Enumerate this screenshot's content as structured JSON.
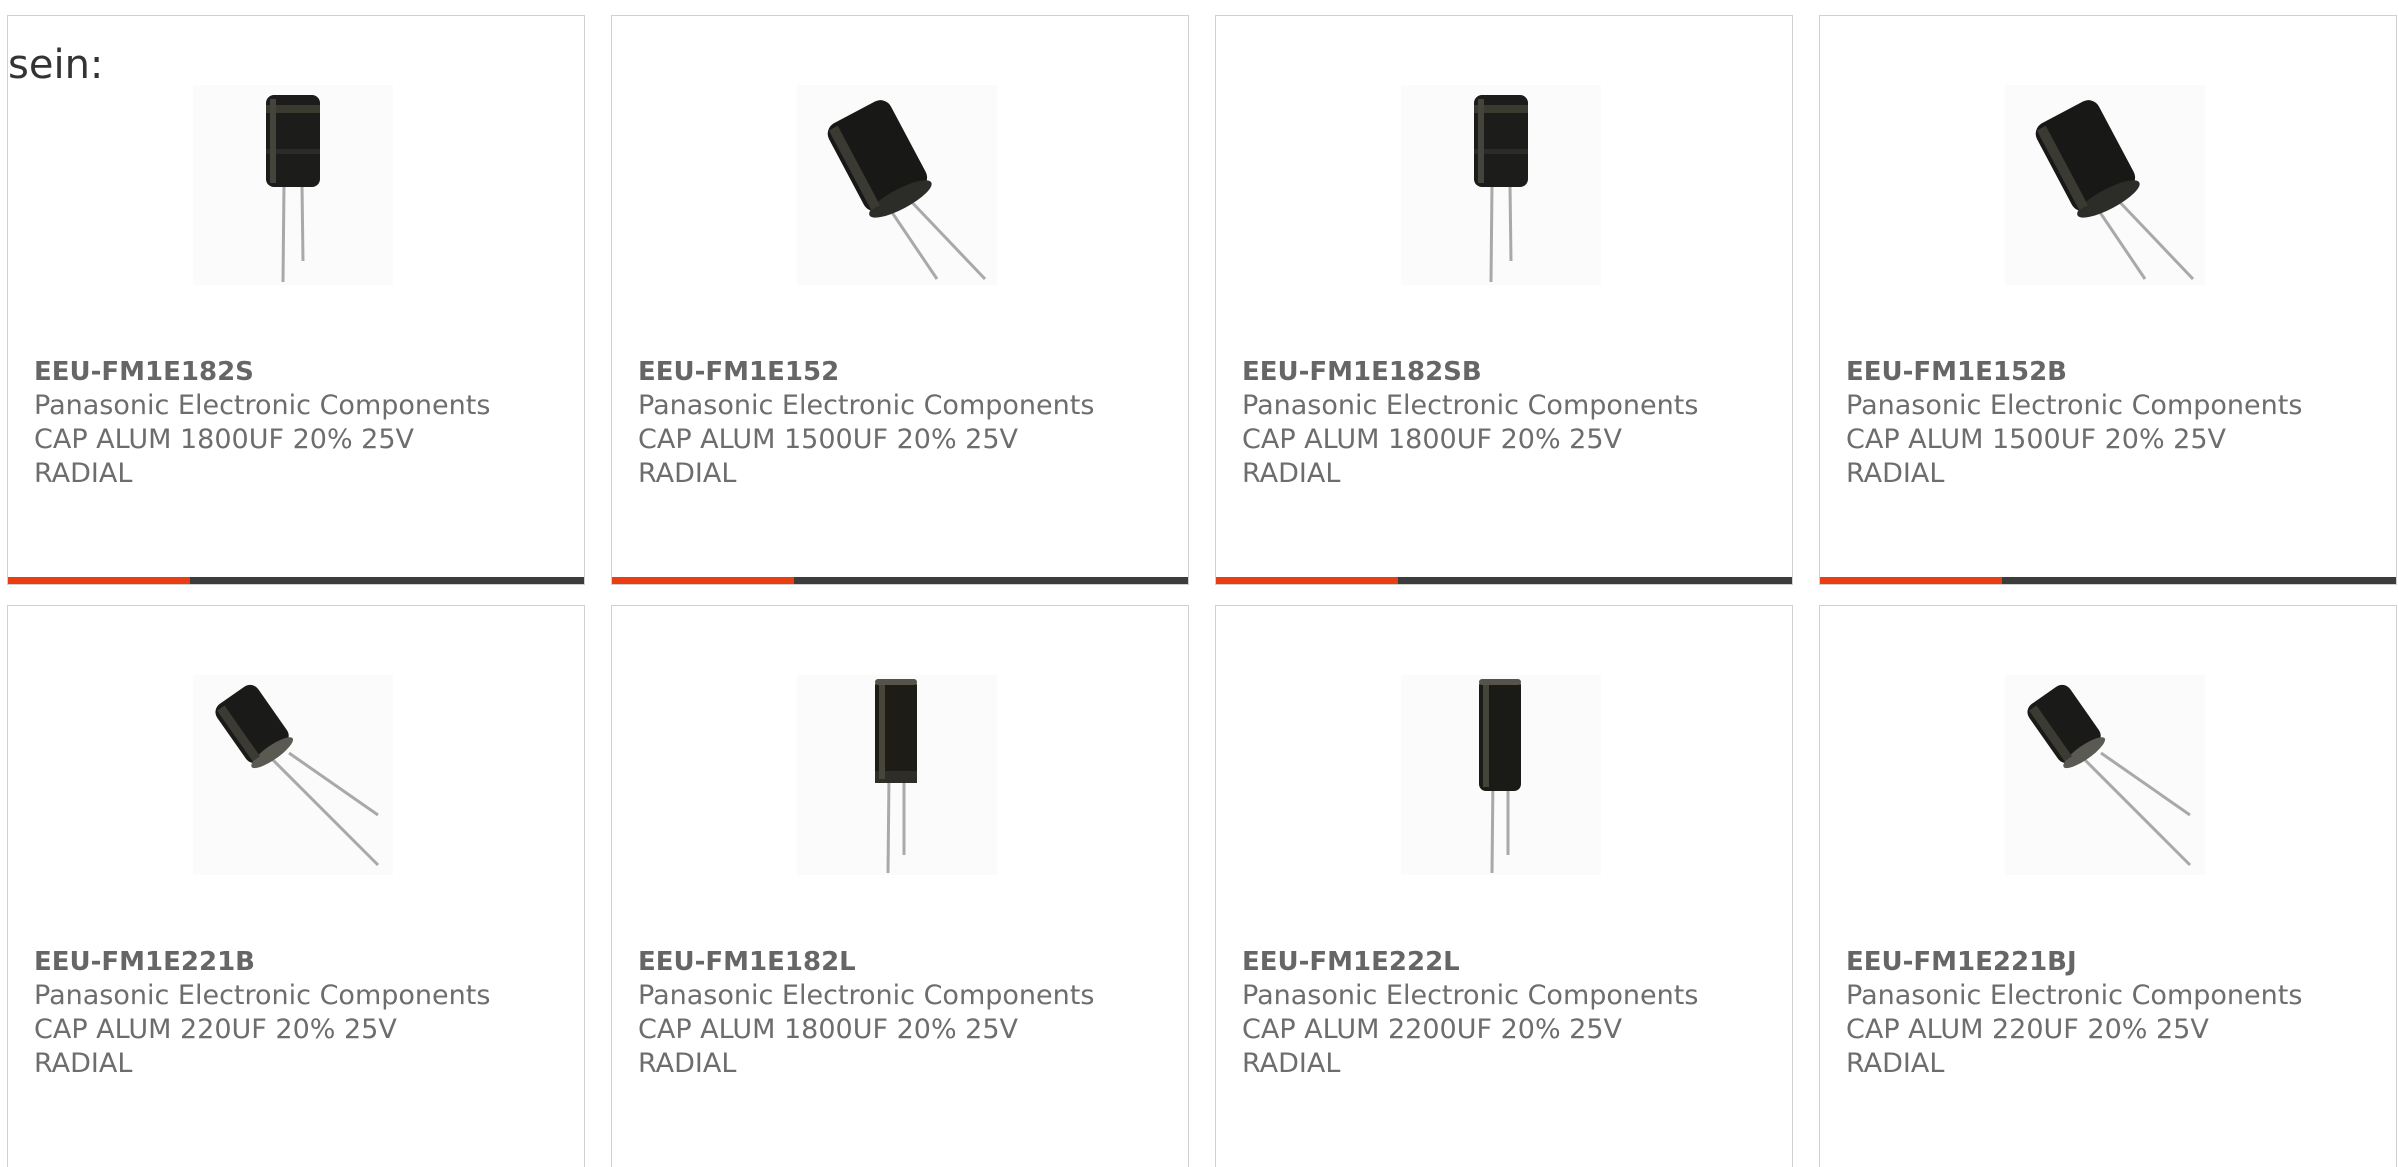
{
  "intro_text": "sein:",
  "colors": {
    "accent": "#ea3d12",
    "bar": "#3c3c3c"
  },
  "products": [
    {
      "part_number": "EEU-FM1E182S",
      "manufacturer": "Panasonic Electronic Components",
      "desc_line1": "CAP ALUM 1800UF 20% 25V",
      "desc_line2": "RADIAL",
      "image": "capacitor-upright-icon"
    },
    {
      "part_number": "EEU-FM1E152",
      "manufacturer": "Panasonic Electronic Components",
      "desc_line1": "CAP ALUM 1500UF 20% 25V",
      "desc_line2": "RADIAL",
      "image": "capacitor-tilted-icon"
    },
    {
      "part_number": "EEU-FM1E182SB",
      "manufacturer": "Panasonic Electronic Components",
      "desc_line1": "CAP ALUM 1800UF 20% 25V",
      "desc_line2": "RADIAL",
      "image": "capacitor-upright-icon"
    },
    {
      "part_number": "EEU-FM1E152B",
      "manufacturer": "Panasonic Electronic Components",
      "desc_line1": "CAP ALUM 1500UF 20% 25V",
      "desc_line2": "RADIAL",
      "image": "capacitor-tilted-icon"
    },
    {
      "part_number": "EEU-FM1E221B",
      "manufacturer": "Panasonic Electronic Components",
      "desc_line1": "CAP ALUM 220UF 20% 25V",
      "desc_line2": "RADIAL",
      "image": "capacitor-small-tilted-icon"
    },
    {
      "part_number": "EEU-FM1E182L",
      "manufacturer": "Panasonic Electronic Components",
      "desc_line1": "CAP ALUM 1800UF 20% 25V",
      "desc_line2": "RADIAL",
      "image": "capacitor-tall-icon"
    },
    {
      "part_number": "EEU-FM1E222L",
      "manufacturer": "Panasonic Electronic Components",
      "desc_line1": "CAP ALUM 2200UF 20% 25V",
      "desc_line2": "RADIAL",
      "image": "capacitor-tall-icon"
    },
    {
      "part_number": "EEU-FM1E221BJ",
      "manufacturer": "Panasonic Electronic Components",
      "desc_line1": "CAP ALUM 220UF 20% 25V",
      "desc_line2": "RADIAL",
      "image": "capacitor-small-tilted-icon"
    }
  ]
}
